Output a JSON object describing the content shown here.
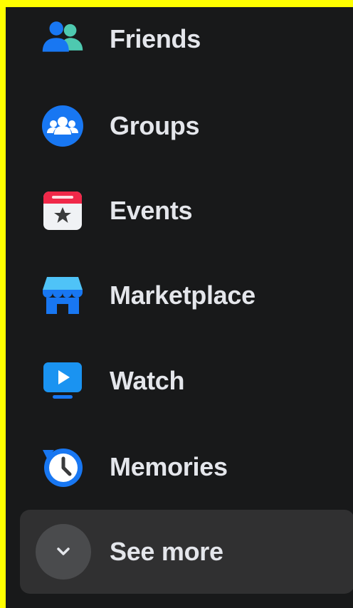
{
  "nav": {
    "items": [
      {
        "label": "Friends",
        "icon": "friends-icon"
      },
      {
        "label": "Groups",
        "icon": "groups-icon"
      },
      {
        "label": "Events",
        "icon": "events-icon"
      },
      {
        "label": "Marketplace",
        "icon": "marketplace-icon"
      },
      {
        "label": "Watch",
        "icon": "watch-icon"
      },
      {
        "label": "Memories",
        "icon": "memories-icon"
      }
    ],
    "see_more": {
      "label": "See more",
      "icon": "chevron-down-icon"
    }
  },
  "colors": {
    "background": "#18191a",
    "text": "#e4e6eb",
    "hover": "#303031",
    "accent_blue": "#1877f2",
    "highlight_border": "#ffff00"
  }
}
